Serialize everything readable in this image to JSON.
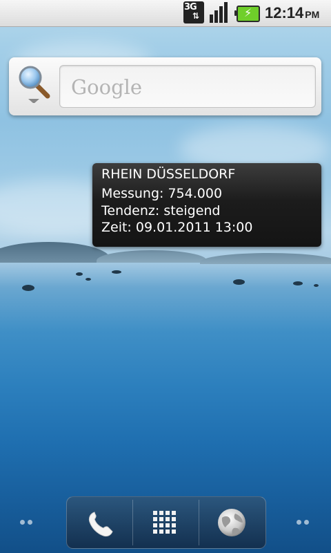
{
  "status_bar": {
    "network_label": "3G",
    "time": "12:14",
    "ampm": "PM",
    "icons": [
      "3g-data-icon",
      "signal-strength-icon",
      "battery-charging-icon"
    ]
  },
  "search_widget": {
    "placeholder": "Google"
  },
  "info_widget": {
    "location": "RHEIN DÜSSELDORF",
    "measurement": "Messung: 754.000",
    "trend": "Tendenz: steigend",
    "time": "Zeit: 09.01.2011 13:00"
  },
  "dock": {
    "icons": [
      "phone-icon",
      "app-drawer-icon",
      "browser-icon"
    ]
  }
}
